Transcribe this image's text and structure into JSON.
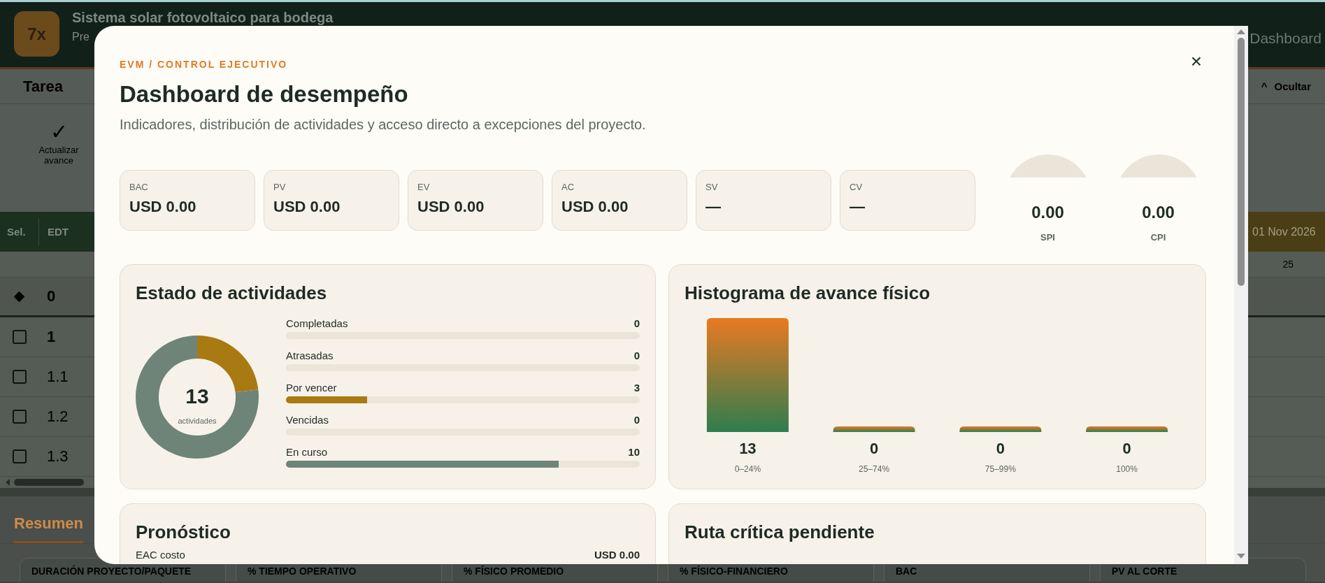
{
  "app": {
    "logo": "7x",
    "title": "Sistema solar fotovoltaico para bodega",
    "subtitle": "Pre",
    "header_button": "Dashboard",
    "tab": "Tarea",
    "hide_button": {
      "icon": "^",
      "label": "Ocultar"
    },
    "ribbon_button": {
      "icon": "✓",
      "label": "Actualizar avance"
    },
    "table": {
      "columns": [
        "Sel.",
        "EDT"
      ],
      "date_header": "01 Nov 2026",
      "day": "25",
      "rows": [
        {
          "kind": "summary",
          "wbs": "0"
        },
        {
          "kind": "task",
          "wbs": "1",
          "bold": true,
          "checked": false
        },
        {
          "kind": "task",
          "wbs": "1.1",
          "bold": false,
          "checked": false
        },
        {
          "kind": "task",
          "wbs": "1.2",
          "bold": false,
          "checked": false
        },
        {
          "kind": "task",
          "wbs": "1.3",
          "bold": false,
          "checked": false
        }
      ]
    },
    "summary": {
      "tab": "Resumen",
      "cards": [
        "DURACIÓN PROYECTO/PAQUETE",
        "% TIEMPO OPERATIVO",
        "% FÍSICO PROMEDIO",
        "% FÍSICO-FINANCIERO",
        "BAC",
        "PV AL CORTE"
      ]
    }
  },
  "modal": {
    "eyebrow": "EVM / CONTROL EJECUTIVO",
    "title": "Dashboard de desempeño",
    "subtitle": "Indicadores, distribución de actividades y acceso directo a excepciones del proyecto.",
    "close": "×",
    "kpis": [
      {
        "label": "BAC",
        "value": "USD 0.00"
      },
      {
        "label": "PV",
        "value": "USD 0.00"
      },
      {
        "label": "EV",
        "value": "USD 0.00"
      },
      {
        "label": "AC",
        "value": "USD 0.00"
      },
      {
        "label": "SV",
        "value": "—"
      },
      {
        "label": "CV",
        "value": "—"
      }
    ],
    "gauges": [
      {
        "label": "SPI",
        "value": "0.00"
      },
      {
        "label": "CPI",
        "value": "0.00"
      }
    ],
    "status": {
      "title": "Estado de actividades",
      "total": "13",
      "total_label": "actividades",
      "items": [
        {
          "label": "Completadas",
          "value": "0",
          "level": 0
        },
        {
          "label": "Atrasadas",
          "value": "0",
          "level": 0
        },
        {
          "label": "Por vencer",
          "value": "3",
          "level": 0.23,
          "color": "#a97a12"
        },
        {
          "label": "Vencidas",
          "value": "0",
          "level": 0
        },
        {
          "label": "En curso",
          "value": "10",
          "level": 0.77,
          "color": "#6f8479"
        }
      ]
    },
    "histogram": {
      "title": "Histograma de avance físico",
      "chart_data": {
        "type": "bar",
        "categories": [
          "0–24%",
          "25–74%",
          "75–99%",
          "100%"
        ],
        "values": [
          13,
          0,
          0,
          0
        ],
        "data_labels": true
      }
    },
    "forecast": {
      "title": "Pronóstico",
      "rows": [
        {
          "label": "EAC costo",
          "value": "USD 0.00"
        }
      ]
    },
    "critical_path": {
      "title": "Ruta crítica pendiente"
    }
  }
}
